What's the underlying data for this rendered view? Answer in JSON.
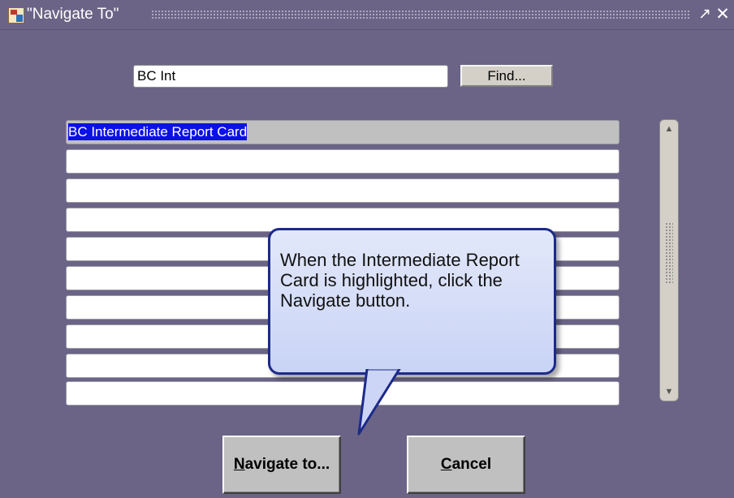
{
  "window": {
    "title": "\"Navigate To\"",
    "icons": [
      "app-icon",
      "maximize-icon",
      "close-icon"
    ]
  },
  "search": {
    "value": "BC Int",
    "find_label": "Find..."
  },
  "results": {
    "selected": "BC Intermediate Report Card",
    "selected_color": "#0b10e8",
    "rows": [
      "BC Intermediate Report Card",
      "",
      "",
      "",
      "",
      "",
      "",
      "",
      "",
      ""
    ]
  },
  "callout": {
    "text": "When the Intermediate Report Card is highlighted, click the Navigate button."
  },
  "buttons": {
    "navigate": {
      "mnemonic": "N",
      "rest": "avigate to..."
    },
    "cancel": {
      "mnemonic": "C",
      "rest": "ancel"
    }
  },
  "colors": {
    "background": "#6b6486",
    "callout_border": "#1c2a8a",
    "callout_fill": "#dbe2f8"
  }
}
